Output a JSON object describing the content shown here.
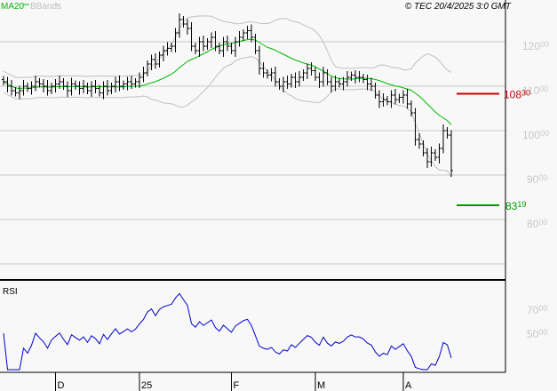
{
  "header": {
    "ma_label": "MA20",
    "bb_label": "BBands",
    "copyright": "© TEC 20/4/2025 3:0 GMT"
  },
  "colors": {
    "ma": "#00bb00",
    "bands": "#c0c0c0",
    "bars": "#000000",
    "rsi": "#0000cc",
    "resistance": "#cc0000",
    "support": "#009900",
    "grid": "#c8c8c8"
  },
  "chart_data": [
    {
      "type": "ohlc",
      "title": "",
      "ylim": [
        77,
        129
      ],
      "yticks": [
        {
          "v": 120,
          "label": "120",
          "sup": "00"
        },
        {
          "v": 110,
          "label": "110",
          "sup": "00"
        },
        {
          "v": 100,
          "label": "100",
          "sup": "00"
        },
        {
          "v": 90,
          "label": "90",
          "sup": "00"
        },
        {
          "v": 80,
          "label": "80",
          "sup": "00"
        }
      ],
      "xticks": [
        {
          "i": 13,
          "label": "D"
        },
        {
          "i": 34,
          "label": "25"
        },
        {
          "i": 57,
          "label": "F"
        },
        {
          "i": 78,
          "label": "M"
        },
        {
          "i": 100,
          "label": "A"
        }
      ],
      "closes": [
        111,
        110,
        109,
        108.5,
        109,
        110,
        109.5,
        110,
        111,
        110.5,
        110,
        109,
        110,
        110.5,
        111,
        110,
        109,
        110.5,
        110,
        109.5,
        110,
        109,
        110,
        109.5,
        108.5,
        110,
        109,
        110,
        111,
        110,
        110.5,
        111,
        110.5,
        111,
        112,
        113,
        115,
        116,
        115,
        117,
        118,
        118.5,
        119,
        122,
        125,
        124,
        123,
        119,
        118,
        120,
        119,
        120,
        121,
        119,
        118,
        120,
        119,
        118,
        120,
        121,
        122,
        122.5,
        121,
        118,
        114,
        113,
        112.5,
        113,
        111,
        110,
        111,
        110.5,
        112,
        111,
        112,
        113,
        114,
        113.5,
        112,
        111,
        113,
        111,
        110,
        111,
        110.5,
        111,
        112,
        112.5,
        112,
        112,
        111.5,
        110.5,
        110,
        108,
        106.5,
        107,
        106.5,
        108,
        107,
        107.5,
        108,
        106,
        104,
        98,
        97,
        95,
        93,
        95,
        94,
        96,
        100,
        99,
        91
      ],
      "levels": [
        {
          "name": "resistance",
          "value": 108.3,
          "label": "108",
          "sup": "30"
        },
        {
          "name": "support",
          "value": 83.19,
          "label": "83",
          "sup": "19"
        }
      ],
      "indicators": [
        "MA20",
        "BBands"
      ]
    },
    {
      "type": "line",
      "title": "RSI",
      "yticks": [
        {
          "v": 70,
          "label": "70",
          "sup": "00"
        },
        {
          "v": 50,
          "label": "50",
          "sup": "00"
        }
      ],
      "period": 14
    }
  ]
}
